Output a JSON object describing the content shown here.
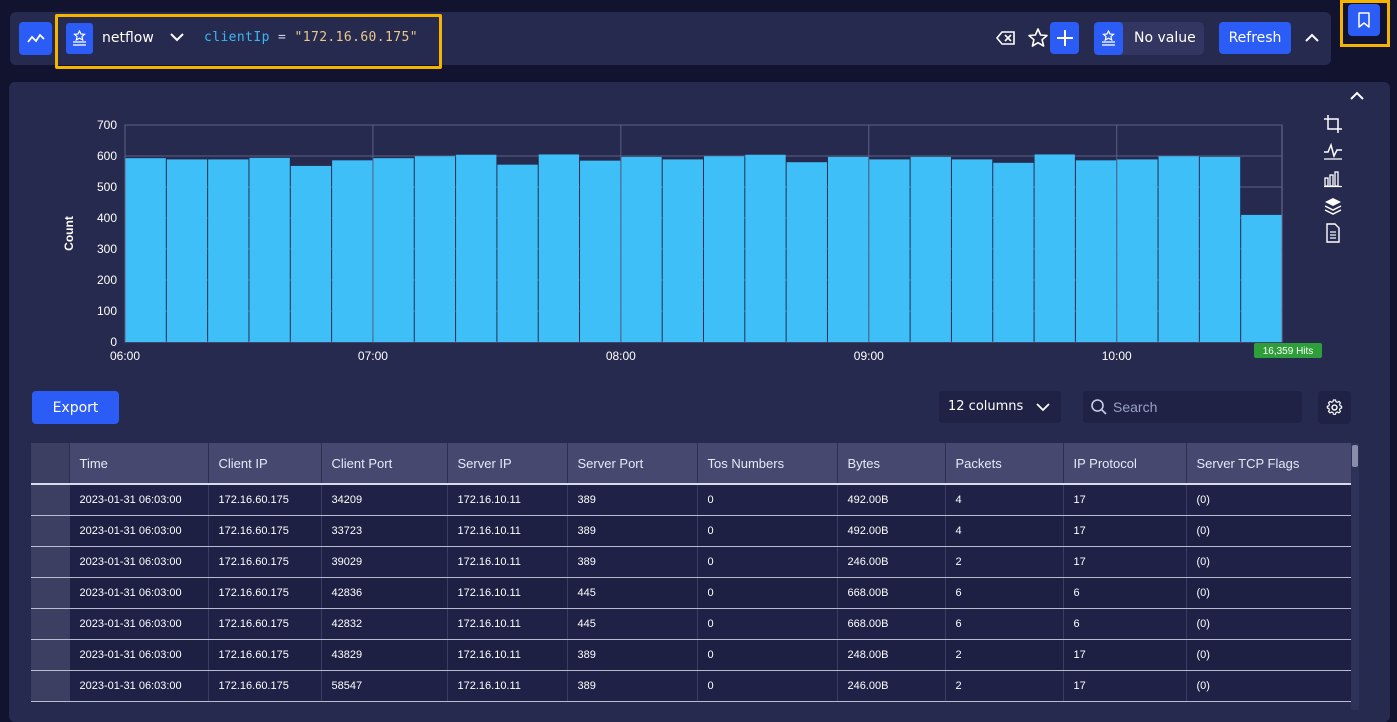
{
  "query_bar": {
    "datasource": "netflow",
    "query_field": "clientIp",
    "query_operator": " = ",
    "query_value": "\"172.16.60.175\"",
    "variable_value": "No value",
    "refresh_label": "Refresh"
  },
  "icons": {
    "viz_toggle": "line-chart-icon",
    "datasource": "database-icon",
    "chevron": "chevron-down-icon",
    "clear": "clear-input-icon",
    "star": "star-icon",
    "plus": "plus-icon",
    "collapse": "chevron-up-icon",
    "bookmark": "bookmark-icon",
    "side_tools": [
      "crop-icon",
      "line-chart-icon",
      "bar-chart-icon",
      "layers-icon",
      "document-icon"
    ],
    "search": "search-icon",
    "settings": "gear-icon"
  },
  "colors": {
    "accent": "#2b5cf6",
    "bar": "#3fbff8",
    "highlight": "#f5b400",
    "hits_badge": "#2e9e3a"
  },
  "chart_data": {
    "type": "bar",
    "ylabel": "Count",
    "xlabel": "",
    "ylim": [
      0,
      700
    ],
    "y_ticks": [
      0,
      100,
      200,
      300,
      400,
      500,
      600,
      700
    ],
    "x_ticks": [
      "06:00",
      "07:00",
      "08:00",
      "09:00",
      "10:00"
    ],
    "x_start": "06:00",
    "x_end": "10:40",
    "bin_minutes": 10,
    "values": [
      593,
      589,
      589,
      594,
      568,
      586,
      593,
      599,
      604,
      572,
      605,
      585,
      597,
      589,
      599,
      604,
      580,
      597,
      589,
      597,
      589,
      578,
      605,
      586,
      589,
      599,
      597,
      410
    ],
    "grid": true,
    "hits_label": "16,359 Hits"
  },
  "toolbar": {
    "export_label": "Export",
    "columns_label": "12 columns",
    "search_placeholder": "Search"
  },
  "table": {
    "columns": [
      "Time",
      "Client IP",
      "Client Port",
      "Server IP",
      "Server Port",
      "Tos Numbers",
      "Bytes",
      "Packets",
      "IP Protocol",
      "Server TCP Flags"
    ],
    "rows": [
      [
        "2023-01-31 06:03:00",
        "172.16.60.175",
        "34209",
        "172.16.10.11",
        "389",
        "0",
        "492.00B",
        "4",
        "17",
        "(0)"
      ],
      [
        "2023-01-31 06:03:00",
        "172.16.60.175",
        "33723",
        "172.16.10.11",
        "389",
        "0",
        "492.00B",
        "4",
        "17",
        "(0)"
      ],
      [
        "2023-01-31 06:03:00",
        "172.16.60.175",
        "39029",
        "172.16.10.11",
        "389",
        "0",
        "246.00B",
        "2",
        "17",
        "(0)"
      ],
      [
        "2023-01-31 06:03:00",
        "172.16.60.175",
        "42836",
        "172.16.10.11",
        "445",
        "0",
        "668.00B",
        "6",
        "6",
        "(0)"
      ],
      [
        "2023-01-31 06:03:00",
        "172.16.60.175",
        "42832",
        "172.16.10.11",
        "445",
        "0",
        "668.00B",
        "6",
        "6",
        "(0)"
      ],
      [
        "2023-01-31 06:03:00",
        "172.16.60.175",
        "43829",
        "172.16.10.11",
        "389",
        "0",
        "248.00B",
        "2",
        "17",
        "(0)"
      ],
      [
        "2023-01-31 06:03:00",
        "172.16.60.175",
        "58547",
        "172.16.10.11",
        "389",
        "0",
        "246.00B",
        "2",
        "17",
        "(0)"
      ]
    ]
  }
}
